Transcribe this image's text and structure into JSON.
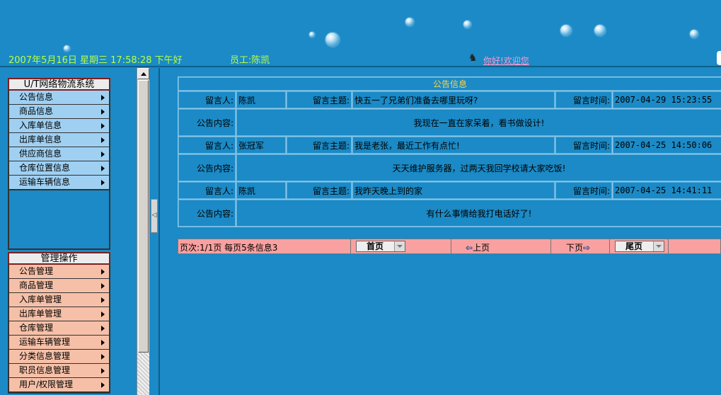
{
  "header": {
    "datetime": "2007年5月16日 星期三 17:58:28 下午好",
    "employee": "员工:陈凯",
    "greeting": "你好!欢迎您"
  },
  "sidebar": {
    "system_title": "U/T网络物流系统",
    "info_items": [
      "公告信息",
      "商品信息",
      "入库单信息",
      "出库单信息",
      "供应商信息",
      "仓库位置信息",
      "运输车辆信息"
    ],
    "manage_title": "管理操作",
    "manage_items": [
      "公告管理",
      "商品管理",
      "入库单管理",
      "出库单管理",
      "仓库管理",
      "运输车辆管理",
      "分类信息管理",
      "职员信息管理",
      "用户/权限管理"
    ]
  },
  "notice": {
    "caption": "公告信息",
    "labels": {
      "author": "留言人:",
      "subject": "留言主题:",
      "time": "留言时间:",
      "content": "公告内容:"
    },
    "rows": [
      {
        "author": "陈凯",
        "subject": "快五一了兄弟们准备去哪里玩呀?",
        "time": "2007-04-29 15:23:55",
        "content": "我现在一直在家呆着，看书做设计!"
      },
      {
        "author": "张冠军",
        "subject": "我是老张，最近工作有点忙!",
        "time": "2007-04-25 14:50:06",
        "content": "天天维护服务器，过两天我回学校请大家吃饭!"
      },
      {
        "author": "陈凯",
        "subject": "我昨天晚上到的家",
        "time": "2007-04-25 14:41:11",
        "content": "有什么事情给我打电话好了!"
      }
    ]
  },
  "pager": {
    "info": "页次:1/1页 每页5条信息3",
    "first": "首页",
    "prev": "上页",
    "next": "下页",
    "last": "尾页"
  },
  "colors": {
    "background": "#1b8ac6",
    "info_menu": "#9fd0f2",
    "manage_menu": "#f6c0a8",
    "pager": "#f9a0a0",
    "caption": "#ffd24a",
    "datetime": "#b8ff40"
  }
}
